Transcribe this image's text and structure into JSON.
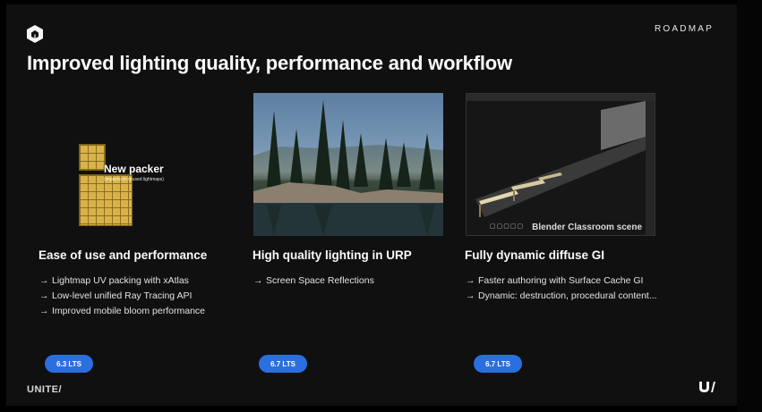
{
  "header": {
    "section_label": "ROADMAP",
    "title": "Improved lighting quality, performance and workflow"
  },
  "columns": [
    {
      "media": {
        "label": "New packer",
        "sublabel": "(impacts on reused lightmaps)"
      },
      "heading": "Ease of use and performance",
      "bullets": [
        "Lightmap UV packing with xAtlas",
        "Low-level unified Ray Tracing API",
        "Improved mobile bloom performance"
      ],
      "badge": "6.3 LTS"
    },
    {
      "heading": "High quality lighting in URP",
      "bullets": [
        "Screen Space Reflections"
      ],
      "badge": "6.7 LTS"
    },
    {
      "media": {
        "caption": "Blender Classroom scene"
      },
      "heading": "Fully dynamic diffuse GI",
      "bullets": [
        "Faster authoring with Surface Cache GI",
        "Dynamic: destruction, procedural content..."
      ],
      "badge": "6.7 LTS"
    }
  ],
  "footer": {
    "brand": "UNITE/"
  },
  "icons": {
    "logo": "unity-cube-icon",
    "bullet": "arrow-right-icon",
    "footer_mark": "unite-logo-icon"
  },
  "colors": {
    "background": "#101010",
    "badge": "#2a6fe0",
    "text": "#f2f2f2"
  }
}
